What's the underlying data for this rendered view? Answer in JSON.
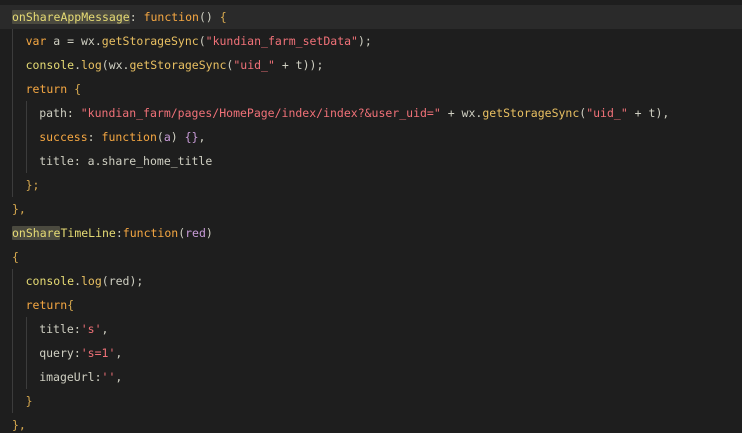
{
  "lines": [
    {
      "indent": 0,
      "tokens": [
        {
          "t": "onShareAppMessage",
          "c": "t-prop",
          "hl": true
        },
        {
          "t": ": ",
          "c": "t-punc"
        },
        {
          "t": "function",
          "c": "t-kw"
        },
        {
          "t": "() ",
          "c": "t-punc"
        },
        {
          "t": "{",
          "c": "t-brace"
        }
      ]
    },
    {
      "indent": 1,
      "tokens": [
        {
          "t": "var",
          "c": "t-kw"
        },
        {
          "t": " a = wx.",
          "c": "t-def"
        },
        {
          "t": "getStorageSync",
          "c": "t-fn"
        },
        {
          "t": "(",
          "c": "t-punc"
        },
        {
          "t": "\"kundian_farm_setData\"",
          "c": "t-str"
        },
        {
          "t": ");",
          "c": "t-punc"
        }
      ]
    },
    {
      "indent": 1,
      "tokens": [
        {
          "t": "console",
          "c": "t-prop"
        },
        {
          "t": ".",
          "c": "t-punc"
        },
        {
          "t": "log",
          "c": "t-fn"
        },
        {
          "t": "(wx.",
          "c": "t-def"
        },
        {
          "t": "getStorageSync",
          "c": "t-fn"
        },
        {
          "t": "(",
          "c": "t-punc"
        },
        {
          "t": "\"uid_\"",
          "c": "t-str"
        },
        {
          "t": " + t));",
          "c": "t-def"
        }
      ]
    },
    {
      "indent": 1,
      "tokens": [
        {
          "t": "return",
          "c": "t-kw"
        },
        {
          "t": " ",
          "c": "t-def"
        },
        {
          "t": "{",
          "c": "t-brace"
        }
      ]
    },
    {
      "indent": 2,
      "tokens": [
        {
          "t": "path",
          "c": "t-def"
        },
        {
          "t": ": ",
          "c": "t-punc"
        },
        {
          "t": "\"kundian_farm/pages/HomePage/index/index?&user_uid=\"",
          "c": "t-str"
        },
        {
          "t": " + wx.",
          "c": "t-def"
        },
        {
          "t": "getStorageSync",
          "c": "t-fn"
        },
        {
          "t": "(",
          "c": "t-punc"
        },
        {
          "t": "\"uid_\"",
          "c": "t-str"
        },
        {
          "t": " + t),",
          "c": "t-def"
        }
      ]
    },
    {
      "indent": 2,
      "tokens": [
        {
          "t": "success",
          "c": "t-kw"
        },
        {
          "t": ": ",
          "c": "t-punc"
        },
        {
          "t": "function",
          "c": "t-kw"
        },
        {
          "t": "(",
          "c": "t-punc"
        },
        {
          "t": "a",
          "c": "t-param"
        },
        {
          "t": ") ",
          "c": "t-punc"
        },
        {
          "t": "{}",
          "c": "t-param"
        },
        {
          "t": ",",
          "c": "t-punc"
        }
      ]
    },
    {
      "indent": 2,
      "tokens": [
        {
          "t": "title",
          "c": "t-def"
        },
        {
          "t": ": a.share_home_title",
          "c": "t-def"
        }
      ]
    },
    {
      "indent": 1,
      "tokens": [
        {
          "t": "};",
          "c": "t-brace"
        }
      ]
    },
    {
      "indent": 0,
      "tokens": [
        {
          "t": "},",
          "c": "t-brace"
        }
      ]
    },
    {
      "indent": 0,
      "tokens": [
        {
          "t": "onShare",
          "c": "t-prop",
          "hl": true
        },
        {
          "t": "TimeLine",
          "c": "t-prop"
        },
        {
          "t": ":",
          "c": "t-punc"
        },
        {
          "t": "function",
          "c": "t-kw"
        },
        {
          "t": "(",
          "c": "t-punc"
        },
        {
          "t": "red",
          "c": "t-param"
        },
        {
          "t": ")",
          "c": "t-punc"
        }
      ]
    },
    {
      "indent": 0,
      "tokens": [
        {
          "t": "{",
          "c": "t-brace"
        }
      ]
    },
    {
      "indent": 1,
      "tokens": [
        {
          "t": "console",
          "c": "t-prop"
        },
        {
          "t": ".",
          "c": "t-punc"
        },
        {
          "t": "log",
          "c": "t-fn"
        },
        {
          "t": "(red);",
          "c": "t-def"
        }
      ]
    },
    {
      "indent": 1,
      "tokens": [
        {
          "t": "return",
          "c": "t-kw"
        },
        {
          "t": "{",
          "c": "t-brace"
        }
      ]
    },
    {
      "indent": 2,
      "tokens": [
        {
          "t": "title",
          "c": "t-def"
        },
        {
          "t": ":",
          "c": "t-punc"
        },
        {
          "t": "'s'",
          "c": "t-str"
        },
        {
          "t": ",",
          "c": "t-punc"
        }
      ]
    },
    {
      "indent": 2,
      "tokens": [
        {
          "t": "query",
          "c": "t-def"
        },
        {
          "t": ":",
          "c": "t-punc"
        },
        {
          "t": "'s=1'",
          "c": "t-str"
        },
        {
          "t": ",",
          "c": "t-punc"
        }
      ]
    },
    {
      "indent": 2,
      "tokens": [
        {
          "t": "imageUrl",
          "c": "t-def"
        },
        {
          "t": ":",
          "c": "t-punc"
        },
        {
          "t": "''",
          "c": "t-str"
        },
        {
          "t": ",",
          "c": "t-punc"
        }
      ]
    },
    {
      "indent": 1,
      "tokens": [
        {
          "t": "}",
          "c": "t-brace"
        }
      ]
    },
    {
      "indent": 0,
      "tokens": [
        {
          "t": "},",
          "c": "t-brace"
        }
      ]
    }
  ]
}
